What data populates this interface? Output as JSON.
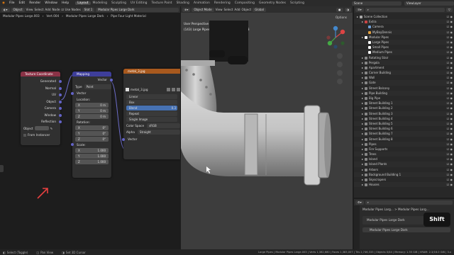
{
  "topbar": {
    "menus": [
      "File",
      "Edit",
      "Render",
      "Window",
      "Help"
    ],
    "workspaces": [
      "Layout",
      "Modeling",
      "Sculpting",
      "UV Editing",
      "Texture Paint",
      "Shading",
      "Animation",
      "Rendering",
      "Compositing",
      "Geometry Nodes",
      "Scripting"
    ],
    "scene": "Scene",
    "viewlayer": "ViewLayer"
  },
  "node_editor": {
    "header": {
      "mode": "Object",
      "menus": [
        "View",
        "Select",
        "Add",
        "Node"
      ],
      "use_nodes": "Use Nodes",
      "slot": "Slot 1",
      "material": "Modular Pipes Large Dark"
    },
    "breadcrumb": [
      "Modular Pipes Large.003",
      "Vert.004",
      "Modular Pipes Large Dark",
      "Pipe Four Light Material"
    ],
    "tex_coord": {
      "title": "Texture Coordinate",
      "outputs": [
        "Generated",
        "Normal",
        "UV",
        "Object",
        "Camera",
        "Window",
        "Reflection"
      ],
      "object_label": "Object",
      "from_instancer": "From Instancer"
    },
    "mapping": {
      "title": "Mapping",
      "output": "Vector",
      "type_label": "Type",
      "type_value": "Point",
      "vector": "Vector",
      "location": "Location:",
      "loc": [
        [
          "X",
          "0 m"
        ],
        [
          "Y",
          "0 m"
        ],
        [
          "Z",
          "0 m"
        ]
      ],
      "rotation": "Rotation:",
      "rot": [
        [
          "X",
          "0°"
        ],
        [
          "Y",
          "0°"
        ],
        [
          "Z",
          "0°"
        ]
      ],
      "scale": "Scale:",
      "scl": [
        [
          "X",
          "1.000"
        ],
        [
          "Y",
          "1.000"
        ],
        [
          "Z",
          "1.000"
        ]
      ]
    },
    "image_tex": {
      "title": "metal_3.jpg",
      "image": "metal_3.jpg",
      "interp": "Linear",
      "proj": "Box",
      "blend": "Blend",
      "blend_val": "0.3",
      "ext": "Repeat",
      "source": "Single Image",
      "cs_label": "Color Space",
      "cs_val": "sRGB",
      "alpha_label": "Alpha",
      "alpha_val": "Straight",
      "vector": "Vector"
    }
  },
  "viewport": {
    "header": {
      "mode": "Object Mode",
      "menus": [
        "View",
        "Select",
        "Add",
        "Object"
      ],
      "orient": "Global",
      "options": "Options"
    },
    "info_line1": "User Perspective (Local)",
    "info_line2": "(143) Large Pipes | Modular Pipes Large.003"
  },
  "outliner": {
    "header": "Scene Collection",
    "items": [
      {
        "label": "Scene Collection",
        "indent": 0,
        "color": "#aaaaaa"
      },
      {
        "label": "Extra",
        "indent": 1,
        "color": "#cc4444"
      },
      {
        "label": "Camera",
        "indent": 2,
        "color": "#6fa0d8"
      },
      {
        "label": "MyBoyDennis",
        "indent": 2,
        "color": "#e0a040"
      },
      {
        "label": "Modular Pipes",
        "indent": 1,
        "color": "#ffffff"
      },
      {
        "label": "Large Pipes",
        "indent": 2,
        "color": "#ffffff"
      },
      {
        "label": "Small Pipes",
        "indent": 2,
        "color": "#ffffff"
      },
      {
        "label": "Medium Pipes",
        "indent": 2,
        "color": "#ffffff"
      },
      {
        "label": "Rotating Stair",
        "indent": 1,
        "color": "#888888"
      },
      {
        "label": "Pergola",
        "indent": 1,
        "color": "#888888"
      },
      {
        "label": "Apartment",
        "indent": 1,
        "color": "#888888"
      },
      {
        "label": "Corner Building",
        "indent": 1,
        "color": "#888888"
      },
      {
        "label": "Wall",
        "indent": 1,
        "color": "#888888"
      },
      {
        "label": "Gate",
        "indent": 1,
        "color": "#888888"
      },
      {
        "label": "Street Balcony",
        "indent": 1,
        "color": "#888888"
      },
      {
        "label": "Pipe Building",
        "indent": 1,
        "color": "#888888"
      },
      {
        "label": "Big Pipe",
        "indent": 1,
        "color": "#888888"
      },
      {
        "label": "Street Building 1",
        "indent": 1,
        "color": "#888888"
      },
      {
        "label": "Street Building 2",
        "indent": 1,
        "color": "#888888"
      },
      {
        "label": "Street Building 3",
        "indent": 1,
        "color": "#888888"
      },
      {
        "label": "Street Building 4",
        "indent": 1,
        "color": "#888888"
      },
      {
        "label": "Street Building 5",
        "indent": 1,
        "color": "#888888"
      },
      {
        "label": "Street Building 6",
        "indent": 1,
        "color": "#888888"
      },
      {
        "label": "Street Building 7",
        "indent": 1,
        "color": "#888888"
      },
      {
        "label": "Street Building 8",
        "indent": 1,
        "color": "#888888"
      },
      {
        "label": "Pipes",
        "indent": 1,
        "color": "#888888"
      },
      {
        "label": "Fire Supports",
        "indent": 1,
        "color": "#888888"
      },
      {
        "label": "Trees",
        "indent": 1,
        "color": "#888888"
      },
      {
        "label": "Island",
        "indent": 1,
        "color": "#888888"
      },
      {
        "label": "Island Plants",
        "indent": 1,
        "color": "#888888"
      },
      {
        "label": "Arbors",
        "indent": 1,
        "color": "#888888"
      },
      {
        "label": "Background Building 1",
        "indent": 1,
        "color": "#888888"
      },
      {
        "label": "Skyscrapers",
        "indent": 1,
        "color": "#888888"
      },
      {
        "label": "Houses",
        "indent": 1,
        "color": "#888888"
      }
    ]
  },
  "properties": {
    "breadcrumb": "Modular Pipes Larg... > Modular Pipes Larg...",
    "slot": "Modular Pipes Large Dark",
    "material": "Modular Pipes Large Dark"
  },
  "status": {
    "select": "Select (Toggle)",
    "pan": "Pan View",
    "cursor": "Set 3D Cursor",
    "stats": "Large Pipes | Modular Pipes Large.003 | Verts 1,382,680 | Faces 1,383,007 | Tris 2,746,333 | Objects 0/44 | Memory: 1.55 GiB | VRAM: 2.3/16.0 GiB | 3.x"
  },
  "key_overlay": "Shift"
}
